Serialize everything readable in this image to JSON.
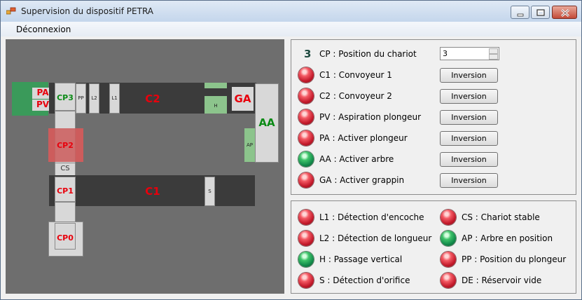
{
  "window": {
    "title": "Supervision du dispositif PETRA"
  },
  "menu": {
    "items": [
      "Déconnexion"
    ]
  },
  "diagram": {
    "PA": "PA",
    "PV": "PV",
    "CP3": "CP3",
    "PP": "PP",
    "L2": "L2",
    "L1": "L1",
    "C2": "C2",
    "H": "H",
    "GA": "GA",
    "AA": "AA",
    "AP": "AP",
    "CP2": "CP2",
    "CS": "CS",
    "CP1": "CP1",
    "C1": "C1",
    "S": "S",
    "CP0": "CP0"
  },
  "actuators": {
    "position": {
      "value_big": "3",
      "label": "CP : Position du chariot",
      "spin_value": "3"
    },
    "rows": [
      {
        "label": "C1 : Convoyeur 1",
        "led": "red",
        "button": "Inversion"
      },
      {
        "label": "C2 : Convoyeur 2",
        "led": "red",
        "button": "Inversion"
      },
      {
        "label": "PV : Aspiration plongeur",
        "led": "red",
        "button": "Inversion"
      },
      {
        "label": "PA : Activer plongeur",
        "led": "red",
        "button": "Inversion"
      },
      {
        "label": "AA : Activer arbre",
        "led": "green",
        "button": "Inversion"
      },
      {
        "label": "GA : Activer grappin",
        "led": "red",
        "button": "Inversion"
      }
    ]
  },
  "sensors": {
    "left": [
      {
        "label": "L1 : Détection d'encoche",
        "led": "red"
      },
      {
        "label": "L2 : Détection de longueur",
        "led": "red"
      },
      {
        "label": "H : Passage vertical",
        "led": "green"
      },
      {
        "label": "S : Détection d'orifice",
        "led": "red"
      }
    ],
    "right": [
      {
        "label": "CS : Chariot stable",
        "led": "red"
      },
      {
        "label": "AP : Arbre en position",
        "led": "green"
      },
      {
        "label": "PP : Position du plongeur",
        "led": "red"
      },
      {
        "label": "DE : Réservoir vide",
        "led": "red"
      }
    ]
  },
  "colors": {
    "red_led": "#d21f2e",
    "green_led": "#14904c",
    "diagram_bg": "#6e6e6e",
    "belt": "#3b3b3b",
    "label_red": "#e8000c",
    "label_green": "#0a8a15"
  }
}
